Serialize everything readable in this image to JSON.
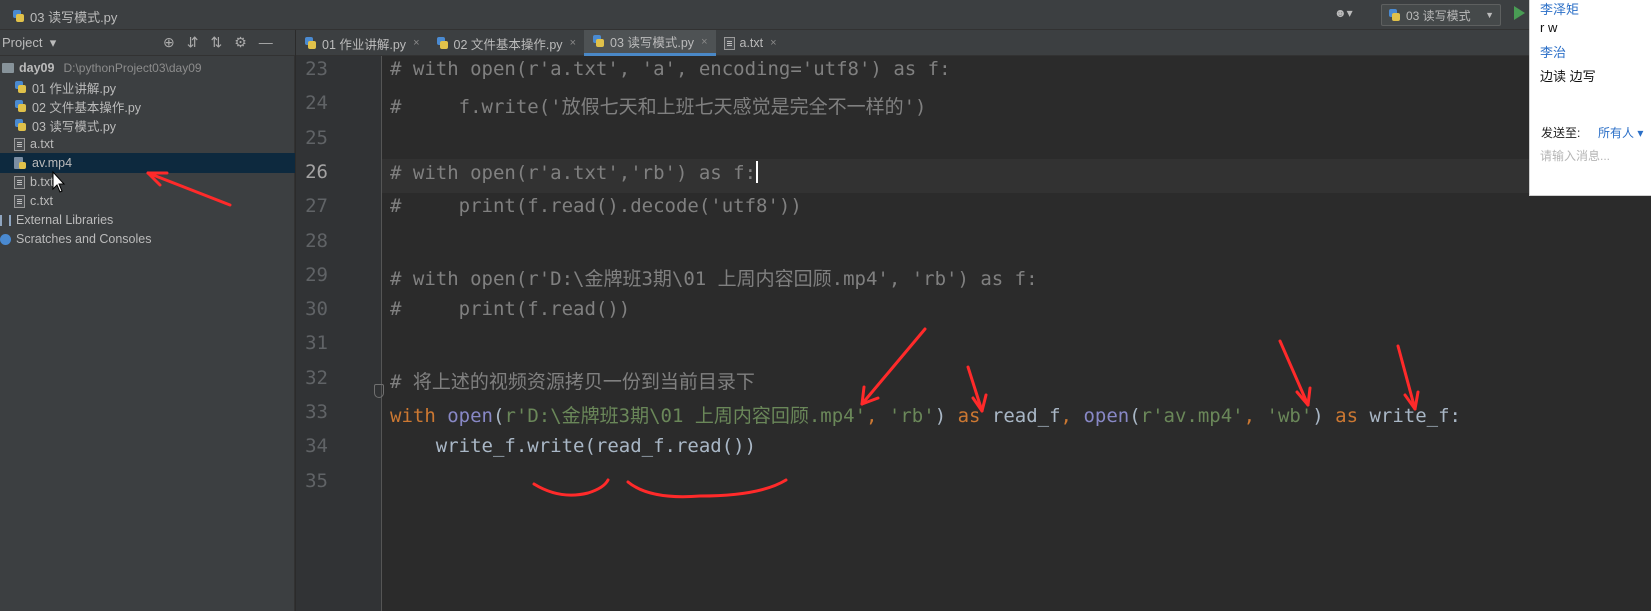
{
  "window": {
    "title": "03 读写模式.py"
  },
  "toolbar": {
    "run_config": "03 读写模式",
    "user_icon": "user-icon"
  },
  "project_panel": {
    "label": "Project",
    "tree": [
      {
        "name": "day09",
        "path": "D:\\pythonProject03\\day09",
        "type": "folder"
      },
      {
        "name": "01 作业讲解.py",
        "type": "py"
      },
      {
        "name": "02 文件基本操作.py",
        "type": "py"
      },
      {
        "name": "03 读写模式.py",
        "type": "py"
      },
      {
        "name": "a.txt",
        "type": "txt"
      },
      {
        "name": "av.mp4",
        "type": "mp4",
        "selected": true
      },
      {
        "name": "b.txt",
        "type": "txt"
      },
      {
        "name": "c.txt",
        "type": "txt"
      },
      {
        "name": "External Libraries",
        "type": "lib"
      },
      {
        "name": "Scratches and Consoles",
        "type": "scratch"
      }
    ]
  },
  "tabs": [
    {
      "label": "01 作业讲解.py",
      "type": "py",
      "active": false
    },
    {
      "label": "02 文件基本操作.py",
      "type": "py",
      "active": false
    },
    {
      "label": "03 读写模式.py",
      "type": "py",
      "active": true
    },
    {
      "label": "a.txt",
      "type": "txt",
      "active": false
    }
  ],
  "editor": {
    "current_line": 26,
    "lines": [
      {
        "num": "23",
        "text": "# with open(r'a.txt', 'a', encoding='utf8') as f:"
      },
      {
        "num": "24",
        "text": "#     f.write('放假七天和上班七天感觉是完全不一样的')"
      },
      {
        "num": "25",
        "text": ""
      },
      {
        "num": "26",
        "text": "# with open(r'a.txt','rb') as f:"
      },
      {
        "num": "27",
        "text": "#     print(f.read().decode('utf8'))"
      },
      {
        "num": "28",
        "text": ""
      },
      {
        "num": "29",
        "text": "# with open(r'D:\\金牌班3期\\01 上周内容回顾.mp4', 'rb') as f:"
      },
      {
        "num": "30",
        "text": "#     print(f.read())"
      },
      {
        "num": "31",
        "text": ""
      },
      {
        "num": "32",
        "text": "# 将上述的视频资源拷贝一份到当前目录下"
      },
      {
        "num": "33",
        "text": "with open(r'D:\\金牌班3期\\01 上周内容回顾.mp4', 'rb') as read_f, open(r'av.mp4', 'wb') as write_f:"
      },
      {
        "num": "34",
        "text": "    write_f.write(read_f.read())"
      },
      {
        "num": "35",
        "text": ""
      }
    ],
    "line33_tokens": [
      {
        "t": "with",
        "c": "c-kw"
      },
      {
        "t": " ",
        "c": ""
      },
      {
        "t": "open",
        "c": "c-builtin"
      },
      {
        "t": "(",
        "c": ""
      },
      {
        "t": "r'D:\\金牌班3期\\01 上周内容回顾.mp4'",
        "c": "c-str"
      },
      {
        "t": ", ",
        "c": "c-kw"
      },
      {
        "t": "'rb'",
        "c": "c-str"
      },
      {
        "t": ") ",
        "c": ""
      },
      {
        "t": "as",
        "c": "c-kw"
      },
      {
        "t": " read_f",
        "c": ""
      },
      {
        "t": ", ",
        "c": "c-kw"
      },
      {
        "t": "open",
        "c": "c-builtin"
      },
      {
        "t": "(",
        "c": ""
      },
      {
        "t": "r'av.mp4'",
        "c": "c-str"
      },
      {
        "t": ", ",
        "c": "c-kw"
      },
      {
        "t": "'wb'",
        "c": "c-str"
      },
      {
        "t": ") ",
        "c": ""
      },
      {
        "t": "as",
        "c": "c-kw"
      },
      {
        "t": " write_f:",
        "c": ""
      }
    ]
  },
  "chat": {
    "messages": [
      {
        "text": "李泽矩",
        "kind": "name"
      },
      {
        "text": "r   w",
        "kind": "txt"
      },
      {
        "text": "李治",
        "kind": "name"
      },
      {
        "text": "边读 边写",
        "kind": "txt"
      }
    ],
    "send_to_label": "发送至:",
    "recipient": "所有人",
    "input_placeholder": "请输入消息..."
  },
  "colors": {
    "annotation": "#ff2a2a",
    "comment": "#808080",
    "keyword": "#cc7832",
    "string": "#6a8759",
    "builtin": "#8888c6"
  }
}
